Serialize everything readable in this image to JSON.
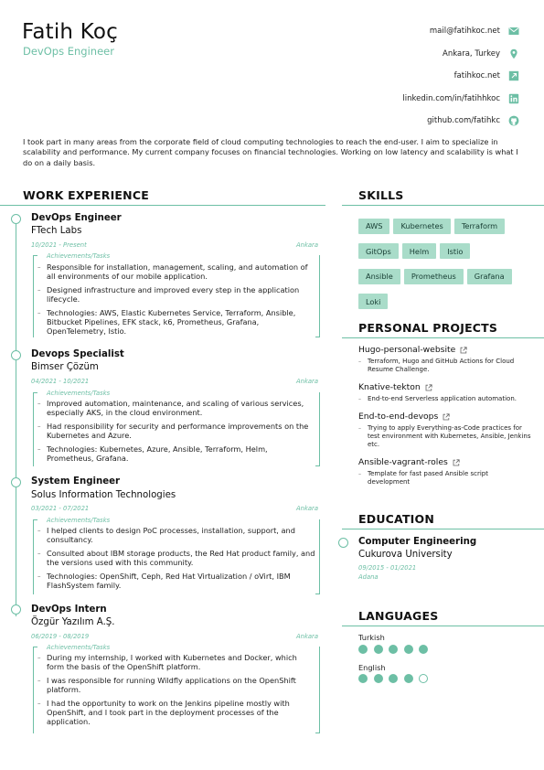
{
  "header": {
    "name": "Fatih Koç",
    "title": "DevOps Engineer",
    "contacts": [
      {
        "text": "mail@fatihkoc.net",
        "icon": "mail-icon"
      },
      {
        "text": "Ankara, Turkey",
        "icon": "location-pin-icon"
      },
      {
        "text": "fatihkoc.net",
        "icon": "link-icon"
      },
      {
        "text": "linkedin.com/in/fatihhkoc",
        "icon": "linkedin-icon"
      },
      {
        "text": "github.com/fatihkc",
        "icon": "github-icon"
      }
    ]
  },
  "summary": "I took part in many areas from the corporate field of cloud computing technologies to reach the end-user. I aim to specialize in scalability and performance. My current company focuses on financial technologies. Working on low latency and scalability is what I do on a daily basis.",
  "work": {
    "heading": "WORK EXPERIENCE",
    "achievements_label": "Achievements/Tasks",
    "jobs": [
      {
        "role": "DevOps Engineer",
        "company": "FTech Labs",
        "dates": "10/2021 - Present",
        "location": "Ankara",
        "items": [
          "Responsible for installation, management, scaling, and automation of all environments of our mobile application.",
          "Designed infrastructure and improved every step in the application lifecycle.",
          "Technologies: AWS, Elastic Kubernetes Service, Terraform, Ansible, Bitbucket Pipelines, EFK stack, k6, Prometheus, Grafana, OpenTelemetry, Istio."
        ]
      },
      {
        "role": "Devops Specialist",
        "company": "Bimser Çözüm",
        "dates": "04/2021 - 10/2021",
        "location": "Ankara",
        "items": [
          "Improved automation, maintenance, and scaling of various services, especially AKS, in the cloud environment.",
          "Had responsibility for security and performance improvements on the Kubernetes and Azure.",
          "Technologies: Kubernetes, Azure, Ansible, Terraform, Helm, Prometheus, Grafana."
        ]
      },
      {
        "role": "System Engineer",
        "company": "Solus Information Technologies",
        "dates": "03/2021 - 07/2021",
        "location": "Ankara",
        "items": [
          "I helped clients to design PoC processes, installation, support, and consultancy.",
          "Consulted about IBM storage products, the Red Hat product family, and the versions used with this community.",
          "Technologies: OpenShift, Ceph, Red Hat Virtualization / oVirt, IBM FlashSystem family."
        ]
      },
      {
        "role": "DevOps Intern",
        "company": "Özgür Yazılım A.Ş.",
        "dates": "06/2019 - 08/2019",
        "location": "Ankara",
        "items": [
          "During my internship, I worked with Kubernetes and Docker, which form the basis of the OpenShift platform.",
          "I was responsible for running Wildfly applications on the OpenShift platform.",
          "I had the opportunity to work on the Jenkins pipeline mostly with OpenShift, and I took part in the deployment processes of the application."
        ]
      }
    ]
  },
  "skills": {
    "heading": "SKILLS",
    "items": [
      "AWS",
      "Kubernetes",
      "Terraform",
      "GitOps",
      "Helm",
      "Istio",
      "Ansible",
      "Prometheus",
      "Grafana",
      "Loki"
    ]
  },
  "projects": {
    "heading": "PERSONAL PROJECTS",
    "items": [
      {
        "name": "Hugo-personal-website",
        "desc": "Terraform, Hugo and GitHub Actions for Cloud Resume Challenge."
      },
      {
        "name": "Knative-tekton",
        "desc": "End-to-end Serverless application automation."
      },
      {
        "name": "End-to-end-devops",
        "desc": "Trying to apply Everything-as-Code practices for test environment with Kubernetes, Ansible, Jenkins etc."
      },
      {
        "name": "Ansible-vagrant-roles",
        "desc": "Template for fast pased Ansible script development"
      }
    ]
  },
  "education": {
    "heading": "EDUCATION",
    "degree": "Computer Engineering",
    "school": "Cukurova University",
    "dates": "09/2015 - 01/2021",
    "location": "Adana"
  },
  "languages": {
    "heading": "LANGUAGES",
    "items": [
      {
        "name": "Turkish",
        "level": 5,
        "max": 5
      },
      {
        "name": "English",
        "level": 4,
        "max": 5
      }
    ]
  },
  "colors": {
    "accent": "#6dbfa5",
    "chip": "#a9dcc9"
  }
}
